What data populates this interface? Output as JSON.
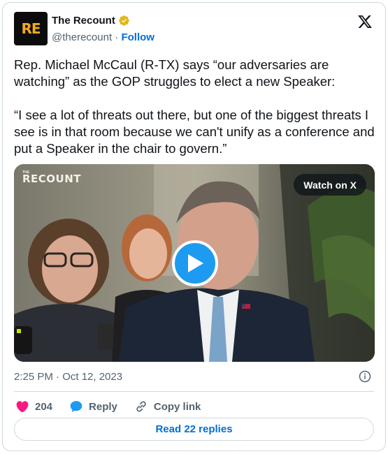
{
  "author": {
    "avatar_text": "RE",
    "display_name": "The Recount",
    "handle": "@therecount",
    "separator": "·",
    "follow_label": "Follow",
    "verified_icon": "verified-gold-badge-icon",
    "verified_color": "#e2b719"
  },
  "brand": {
    "logo_icon": "x-logo-icon"
  },
  "tweet": {
    "paragraphs": [
      "Rep. Michael McCaul (R-TX) says “our adversaries are watching” as the GOP struggles to elect a new Speaker:",
      "“I see a lot of threats out there, but one of the biggest threats I see is in that room because we can't unify as a conference and put a Speaker in the chair to govern.”"
    ]
  },
  "media": {
    "watermark_sup": "THE",
    "watermark": "RECOUNT",
    "watch_label": "Watch on X",
    "play_icon": "play-icon",
    "accent": "#1d9bf0"
  },
  "meta": {
    "timestamp": "2:25 PM · Oct 12, 2023",
    "info_icon": "info-icon"
  },
  "actions": {
    "likes": "204",
    "like_icon": "heart-icon",
    "like_color": "#f91880",
    "reply_label": "Reply",
    "reply_icon": "speech-bubble-icon",
    "reply_color": "#1d9bf0",
    "copy_label": "Copy link",
    "copy_icon": "link-icon"
  },
  "replies_button": "Read 22 replies"
}
